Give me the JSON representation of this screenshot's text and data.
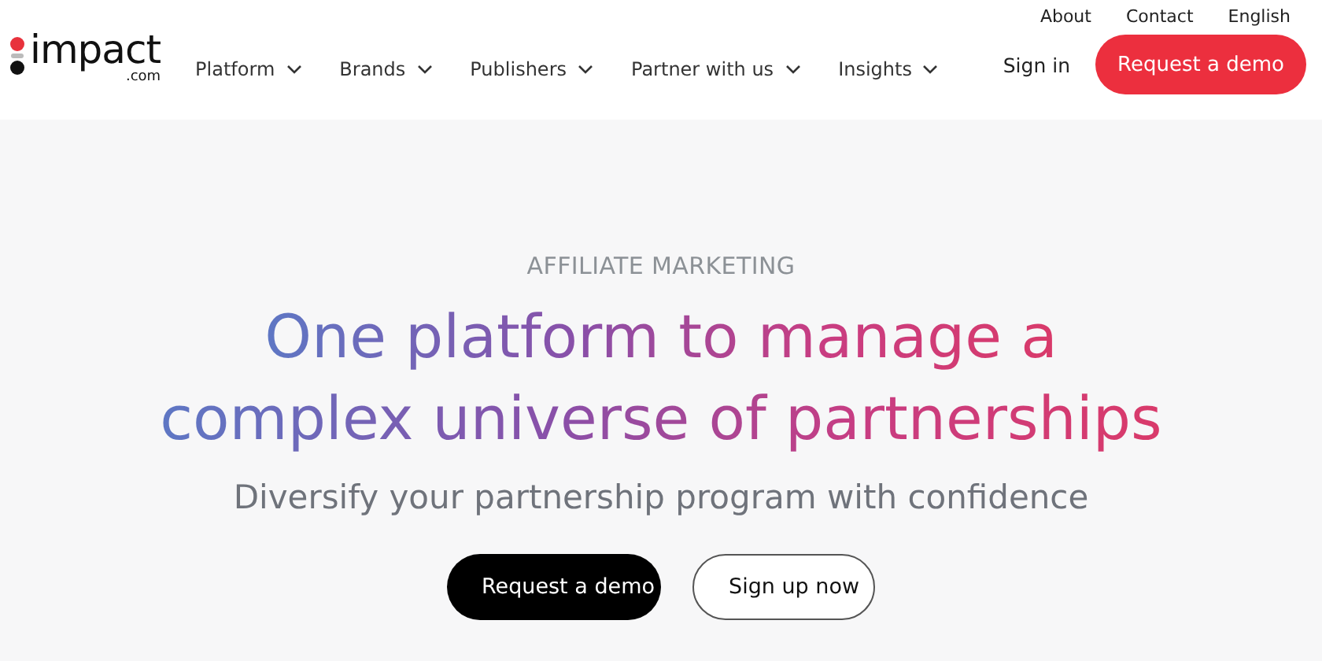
{
  "logo": {
    "name": "impact",
    "suffix": ".com"
  },
  "utility_links": [
    "About",
    "Contact",
    "English"
  ],
  "nav": [
    {
      "label": "Platform"
    },
    {
      "label": "Brands"
    },
    {
      "label": "Publishers"
    },
    {
      "label": "Partner with us"
    },
    {
      "label": "Insights"
    }
  ],
  "sign_in": "Sign in",
  "header_cta": "Request a demo",
  "hero": {
    "eyebrow": "AFFILIATE MARKETING",
    "headline_lines": [
      "One platform to manage a",
      "complex universe of partnerships"
    ],
    "subtitle": "Diversify your partnership program with confidence",
    "buttons": [
      {
        "label": "Request a demo",
        "kind": "primary"
      },
      {
        "label": "Sign up now",
        "kind": "outline"
      }
    ]
  }
}
